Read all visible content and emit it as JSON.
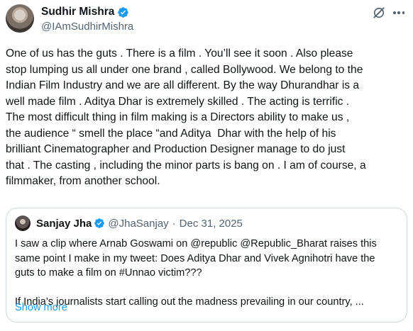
{
  "author": {
    "display_name": "Sudhir Mishra",
    "handle": "@IAmSudhirMishra"
  },
  "tweet": {
    "text": "One of us has the guts . There is a film . You’ll see it soon . Also please\nstop lumping us all under one brand , called Bollywood. We belong to the\nIndian Film Industry and we are all different. By the way Dhurandhar is a\nwell made film . Aditya Dhar is extremely skilled . The acting is terrific .\nThe most difficult thing in film making is a Directors ability to make us ,\nthe audience “ smell the place “and Aditya  Dhar with the help of his\nbrilliant Cinematographer and Production Designer manage to do just\nthat . The casting , including the minor parts is bang on . I am of course, a\nfilmmaker, from another school."
  },
  "quote": {
    "display_name": "Sanjay Jha",
    "handle": "@JhaSanjay",
    "separator": "·",
    "date": "Dec 31, 2025",
    "text": "I saw a clip where Arnab Goswami on @republic @Republic_Bharat raises this\nsame point I make in my tweet: Does Aditya Dhar and Vivek Agnihotri have the\nguts to make a film on #Unnao victim???\n\nIf India’s journalists start calling out the madness prevailing in our country, ...",
    "show_more": "Show more"
  },
  "colors": {
    "text": "#0f1419",
    "secondary": "#536471",
    "accent": "#1d9bf0",
    "border": "#cfd9de"
  },
  "icons": [
    "verified-badge-icon",
    "grok-icon",
    "more-options-icon"
  ]
}
